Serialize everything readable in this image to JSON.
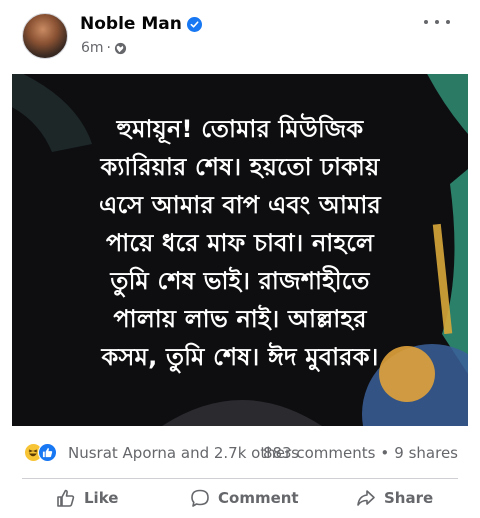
{
  "post": {
    "author": "Noble Man",
    "time": "6m",
    "separator": "·",
    "text_lines": [
      "হুমায়ূন! তোমার মিউজিক",
      "ক্যারিয়ার শেষ। হয়তো ঢাকায়",
      "এসে আমার বাপ এবং আমার",
      "পায়ে ধরে মাফ চাবা। নাহলে",
      "তুমি শেষ ভাই। রাজশাহীতে",
      "পালায় লাভ নাই। আল্লাহর",
      "কসম, তুমি শেষ। ঈদ মুবারক।"
    ]
  },
  "stats": {
    "reaction_names": "Nusrat Aporna and 2.7k others",
    "comments": "883 comments",
    "dot": "•",
    "shares": "9 shares"
  },
  "actions": {
    "like": "Like",
    "comment": "Comment",
    "share": "Share"
  },
  "icons": {
    "verified": "verified-badge-icon",
    "privacy": "globe-icon",
    "more": "more-options-icon",
    "reactions": [
      "haha-icon",
      "like-icon"
    ]
  },
  "colors": {
    "accent": "#1877f2",
    "text_secondary": "#65676b",
    "image_background": "#0e0e10",
    "decor_green": "#2f8d73"
  }
}
